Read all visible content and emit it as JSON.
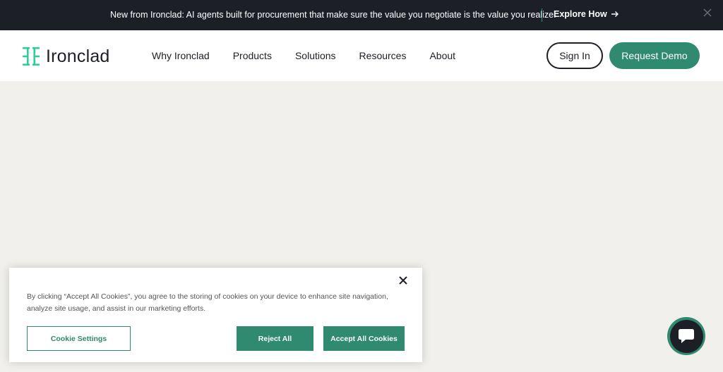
{
  "announcement": {
    "text": "New from Ironclad: AI agents built for procurement that make sure the value you negotiate is the value you realize.",
    "link_label": "Explore How",
    "link_icon": "arrow-right-icon",
    "close_icon": "close-icon"
  },
  "header": {
    "logo_text": "Ironclad",
    "nav": [
      {
        "label": "Why Ironclad"
      },
      {
        "label": "Products"
      },
      {
        "label": "Solutions"
      },
      {
        "label": "Resources"
      },
      {
        "label": "About"
      }
    ],
    "sign_in_label": "Sign In",
    "request_demo_label": "Request Demo"
  },
  "cookie_banner": {
    "text": "By clicking “Accept All Cookies”, you agree to the storing of cookies on your device to enhance site navigation, analyze site usage, and assist in our marketing efforts.",
    "settings_label": "Cookie Settings",
    "reject_label": "Reject All",
    "accept_label": "Accept All Cookies",
    "close_icon": "close-icon"
  },
  "chat_widget": {
    "icon": "chat-bubble-icon"
  },
  "colors": {
    "brand_green": "#2f8a6f",
    "dark": "#1c1f26",
    "page_bg": "#f1f0ed"
  }
}
